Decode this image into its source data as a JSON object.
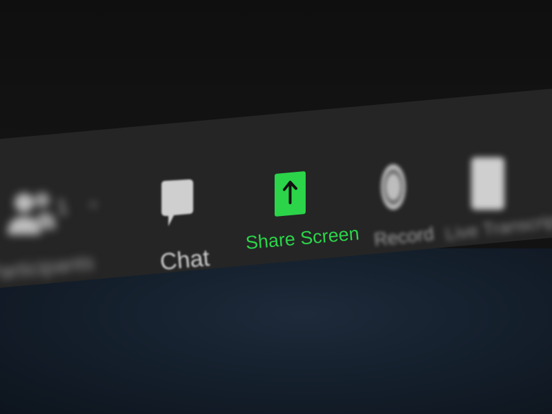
{
  "toolbar": {
    "participants": {
      "label": "Participants",
      "count": "1",
      "caret": "^"
    },
    "chat": {
      "label": "Chat"
    },
    "share_screen": {
      "label": "Share Screen",
      "icon": "share-screen-arrow-icon",
      "accent": "#2bd449"
    },
    "record": {
      "label": "Record"
    },
    "more": {
      "label": "Live Transcript"
    }
  },
  "colors": {
    "toolbar_bg": "#252525",
    "top_bg": "#121212",
    "bottom_bg": "#15202d",
    "accent_green": "#2bd449"
  }
}
